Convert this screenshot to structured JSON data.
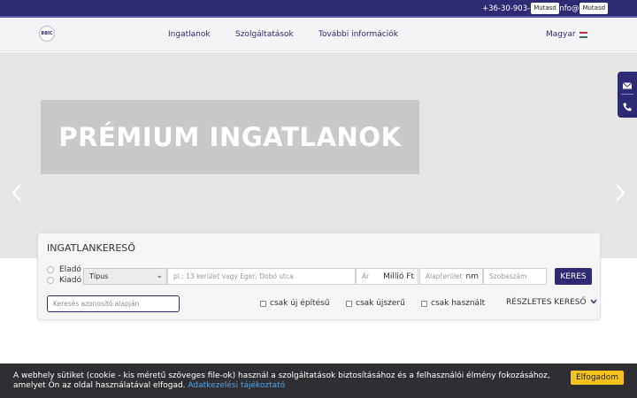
{
  "topbar": {
    "phone": "+36-30-903-",
    "phone_reveal": "Mutasd",
    "email": "info@",
    "email_reveal": "Mutasd"
  },
  "nav": {
    "logo_text": "BBIC",
    "items": [
      {
        "label": "Ingatlanok"
      },
      {
        "label": "Szolgáltatások"
      },
      {
        "label": "További információk"
      }
    ],
    "language": "Magyar",
    "flag_colors": [
      "#cd2a3e",
      "#ffffff",
      "#436f4d"
    ]
  },
  "hero": {
    "title": "PRÉMIUM INGATLANOK",
    "prev_icon": "chevron-left-icon",
    "next_icon": "chevron-right-icon"
  },
  "side": {
    "icons": [
      "envelope-icon",
      "phone-icon"
    ]
  },
  "search": {
    "title": "INGATLANKERESŐ",
    "radio_sale": "Eladó",
    "radio_rent": "Kiadó",
    "type_select": "Típus",
    "location_placeholder": "pl.: 13 kerület vagy Eger, Dobó utca",
    "price_placeholder": "Ár",
    "price_unit": "Millió Ft",
    "area_placeholder": "Alapterület",
    "area_unit": "nm",
    "rooms_placeholder": "Szobaszám",
    "button": "KERES",
    "id_placeholder": "Keresés azonosító alapján",
    "check_new": "csak új építésű",
    "check_newlike": "csak újszerű",
    "check_used": "csak használt",
    "detailed": "RÉSZLETES KERESŐ"
  },
  "cookie": {
    "text": "A webhely sütiket (cookie - kis méretű szöveges file-ok) használ a szolgáltatások biztosításához és a felhasználói élmény fokozásához, amelyet Ön az oldal használatával elfogad.",
    "link": "Adatkezelési tájékoztató",
    "accept": "Elfogadom"
  },
  "colors": {
    "brand": "#2e2a73",
    "accent_yellow": "#f4c21d",
    "cookie_bg": "#2f2f33"
  }
}
